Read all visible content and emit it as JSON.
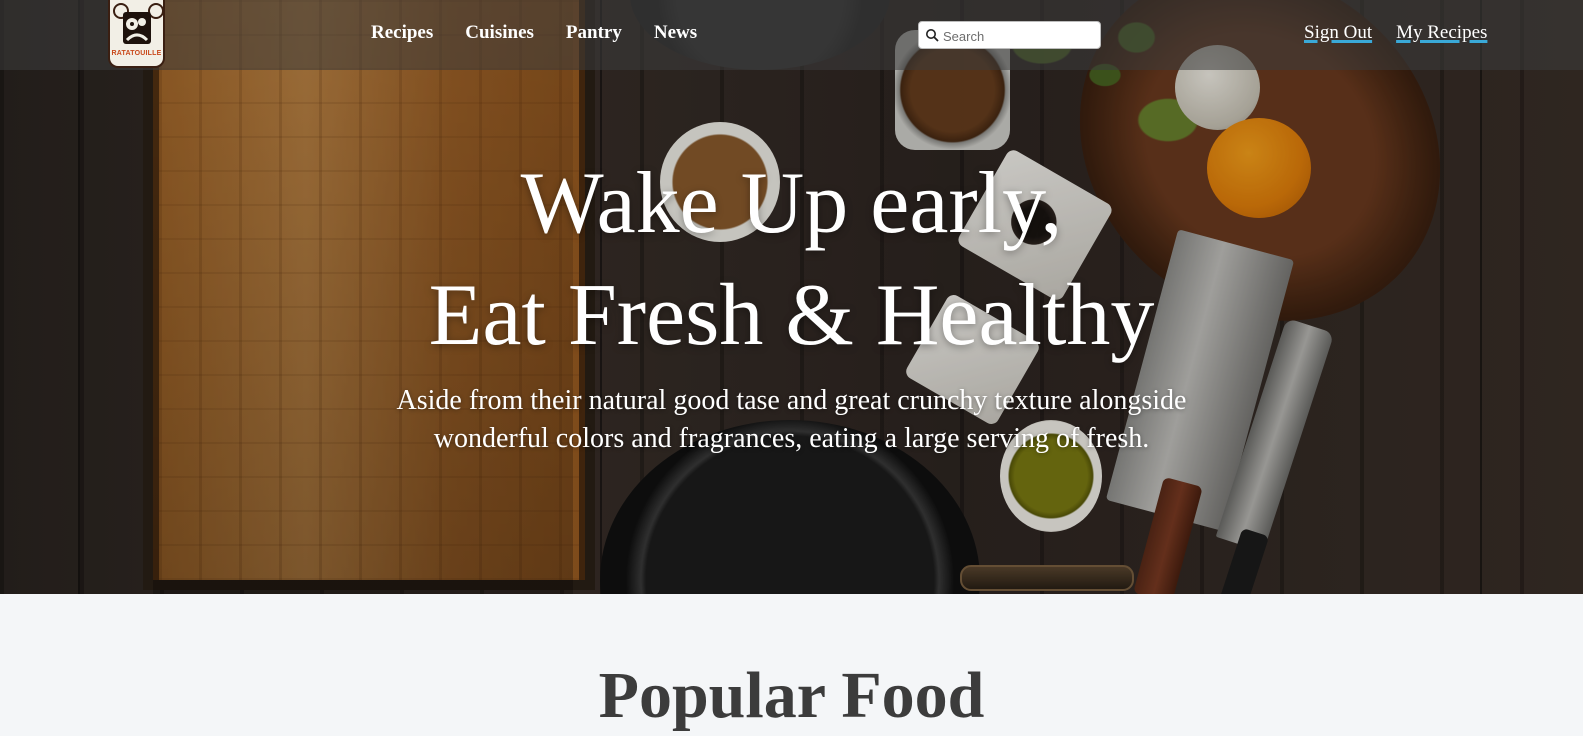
{
  "brand": {
    "logo_text": "RATATOUILLE",
    "colors": {
      "accent_underline": "#3aa9d8",
      "nav_bg": "rgba(60,60,60,0.55)",
      "section_bg": "#f4f6f8"
    }
  },
  "nav": {
    "links": [
      {
        "label": "Recipes"
      },
      {
        "label": "Cuisines"
      },
      {
        "label": "Pantry"
      },
      {
        "label": "News"
      }
    ],
    "search": {
      "placeholder": "Search",
      "value": "",
      "icon": "search-icon"
    },
    "account": [
      {
        "label": "Sign Out"
      },
      {
        "label": "My Recipes"
      }
    ]
  },
  "hero": {
    "title_line1": "Wake Up early,",
    "title_line2": "Eat Fresh & Healthy",
    "subtitle": "Aside from their natural good tase and great crunchy texture alongside wonderful colors and fragrances, eating a large serving of fresh."
  },
  "popular": {
    "title": "Popular Food"
  }
}
